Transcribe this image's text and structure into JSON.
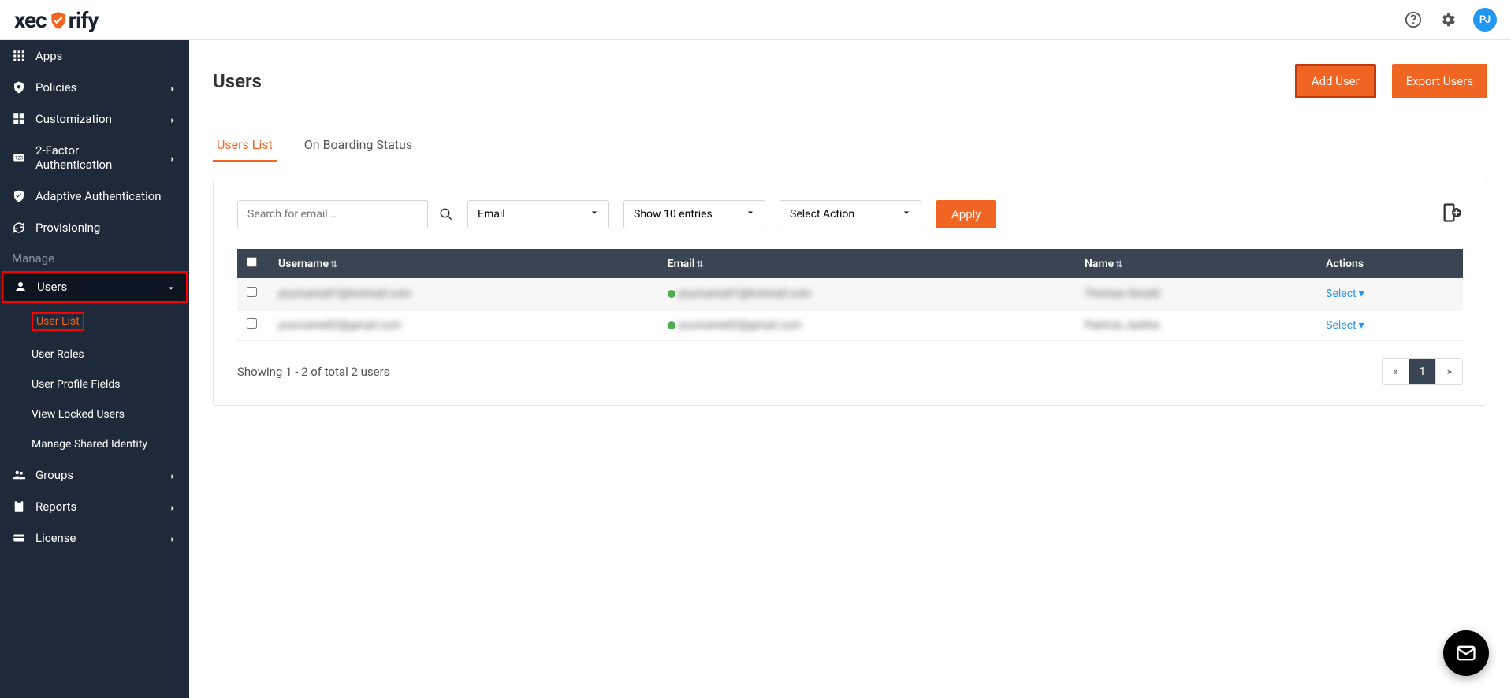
{
  "header": {
    "logo_text_1": "xec",
    "logo_text_2": "rify",
    "avatar_initials": "PJ"
  },
  "sidebar": {
    "items": [
      {
        "label": "Apps",
        "icon": "apps-icon",
        "has_children": false
      },
      {
        "label": "Policies",
        "icon": "shield-icon",
        "has_children": true
      },
      {
        "label": "Customization",
        "icon": "customize-icon",
        "has_children": true
      },
      {
        "label": "2-Factor Authentication",
        "icon": "2fa-icon",
        "has_children": true
      },
      {
        "label": "Adaptive Authentication",
        "icon": "adaptive-icon",
        "has_children": false
      },
      {
        "label": "Provisioning",
        "icon": "sync-icon",
        "has_children": false
      }
    ],
    "manage_label": "Manage",
    "users_label": "Users",
    "users_sub": [
      {
        "label": "User List",
        "active": true
      },
      {
        "label": "User Roles",
        "active": false
      },
      {
        "label": "User Profile Fields",
        "active": false
      },
      {
        "label": "View Locked Users",
        "active": false
      },
      {
        "label": "Manage Shared Identity",
        "active": false
      }
    ],
    "bottom_items": [
      {
        "label": "Groups",
        "icon": "groups-icon"
      },
      {
        "label": "Reports",
        "icon": "reports-icon"
      },
      {
        "label": "License",
        "icon": "license-icon"
      }
    ]
  },
  "page": {
    "title": "Users",
    "add_user_label": "Add User",
    "export_users_label": "Export Users"
  },
  "tabs": {
    "users_list": "Users List",
    "onboarding": "On Boarding Status"
  },
  "filters": {
    "search_placeholder": "Search for email...",
    "email_select": "Email",
    "show_entries": "Show 10 entries",
    "select_action": "Select Action",
    "apply_label": "Apply"
  },
  "table": {
    "columns": {
      "username": "Username",
      "email": "Email",
      "name": "Name",
      "actions": "Actions"
    },
    "rows": [
      {
        "username": "yourname01@hotmail.com",
        "email": "yourname01@hotmail.com",
        "name": "Thomas Gerald",
        "action_label": "Select"
      },
      {
        "username": "yourname02@gmail.com",
        "email": "yourname02@gmail.com",
        "name": "Patricia Jasline",
        "action_label": "Select"
      }
    ],
    "footer_text": "Showing 1 - 2 of total 2 users",
    "pagination": {
      "prev": "«",
      "current": "1",
      "next": "»"
    }
  }
}
